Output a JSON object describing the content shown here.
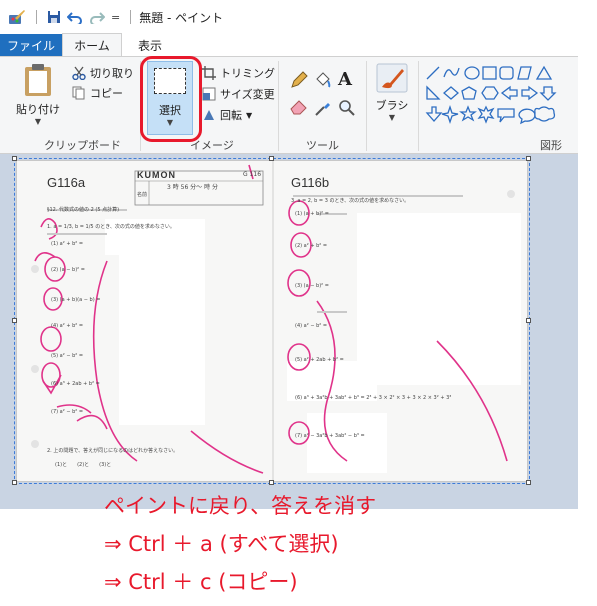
{
  "window": {
    "title": "無題 - ペイント",
    "qa_dropdown": "="
  },
  "tabs": [
    "ファイル",
    "ホーム",
    "表示"
  ],
  "ribbon": {
    "clipboard": {
      "paste_label": "貼り付け",
      "cut_label": "切り取り",
      "copy_label": "コピー",
      "group_label": "クリップボード"
    },
    "image": {
      "select_label": "選択",
      "crop_label": "トリミング",
      "resize_label": "サイズ変更",
      "rotate_label": "回転",
      "group_label": "イメージ"
    },
    "tools": {
      "text_tool_label": "A",
      "group_label": "ツール"
    },
    "brushes": {
      "label": "ブラシ"
    },
    "shapes": {
      "group_label": "図形"
    }
  },
  "worksheet": {
    "left_code": "G116a",
    "brand": "KUMON",
    "time_label": "3 時 56 分〜 時 分",
    "name_label": "名前",
    "page_code": "G 116",
    "left_intro": "§12. 代数式の値の 2 (5 点計算)",
    "left_q1": "1. a = 1/3, b = 1/5 のとき、次の式の値を求めなさい。",
    "left_items": [
      "(1) a² + b² =",
      "(2) (a − b)² =",
      "(3) (a + b)(a − b) =",
      "(4) a² + b² =",
      "(5) a² − b² =",
      "(6) a³ + 2ab + b² =",
      "(7) a² − b² ="
    ],
    "left_q2": "2. 上の問題で、答えが同じになるのはどれか答えなさい。",
    "left_q2_blank": "(1)と　　(2)と　　(3)と",
    "right_code": "G116b",
    "right_q3": "3. a = 2, b = 3 のとき、次の式の値を求めなさい。",
    "right_items": [
      "(1) (a + b)² =",
      "(2) a² + b² =",
      "(3) (a − b)² =",
      "(4) a² − b² =",
      "(5) a² + 2ab + b² =",
      "(6) a³ + 3a²b + 3ab² + b³ = 2³ + 3 × 2² × 3 + 3 × 2 × 3² + 3³",
      "(7) a² − 3a²b + 3ab² − b³ ="
    ]
  },
  "captions": [
    "ペイントに戻り、答えを消す",
    "⇒ Ctrl ＋ a (すべて選択)",
    "⇒ Ctrl ＋ c (コピー)"
  ],
  "colors": {
    "file_tab": "#1f6fbf",
    "highlight": "#e8192c",
    "select_button": "#c5e0f7",
    "caption": "#e8192c"
  }
}
